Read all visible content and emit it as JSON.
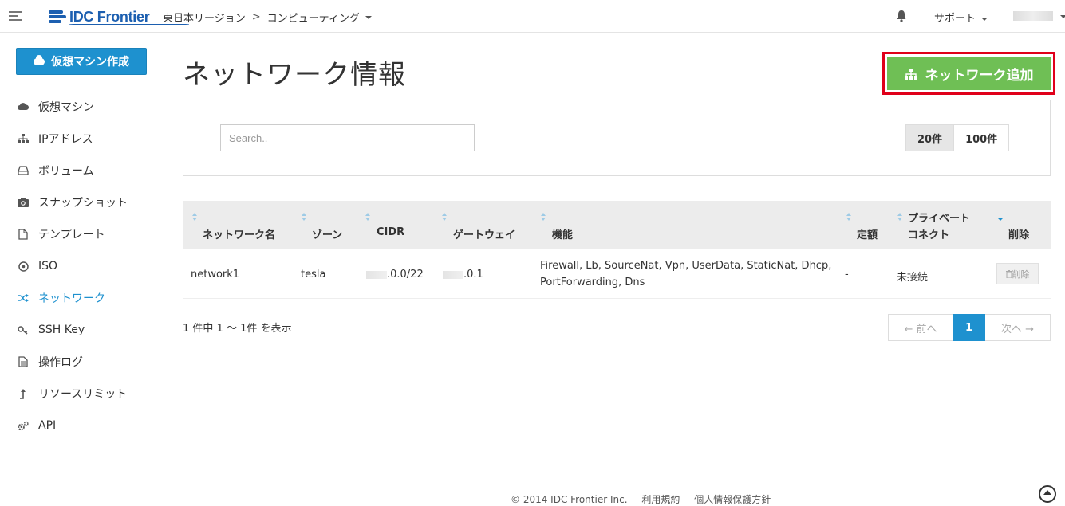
{
  "header": {
    "logo_text": "IDC Frontier",
    "region": "東日本リージョン",
    "breadcrumb_sep": ">",
    "section": "コンピューティング",
    "support": "サポート"
  },
  "sidebar": {
    "create_label": "仮想マシン作成",
    "items": [
      {
        "label": "仮想マシン",
        "icon": "cloud-icon"
      },
      {
        "label": "IPアドレス",
        "icon": "sitemap-icon"
      },
      {
        "label": "ボリューム",
        "icon": "hdd-icon"
      },
      {
        "label": "スナップショット",
        "icon": "camera-icon"
      },
      {
        "label": "テンプレート",
        "icon": "file-icon"
      },
      {
        "label": "ISO",
        "icon": "disc-icon"
      },
      {
        "label": "ネットワーク",
        "icon": "shuffle-icon",
        "active": true
      },
      {
        "label": "SSH Key",
        "icon": "key-icon"
      },
      {
        "label": "操作ログ",
        "icon": "document-icon"
      },
      {
        "label": "リソースリミット",
        "icon": "level-up-icon"
      },
      {
        "label": "API",
        "icon": "cogs-icon"
      }
    ]
  },
  "main": {
    "title": "ネットワーク情報",
    "add_label": "ネットワーク追加",
    "search_placeholder": "Search..",
    "page_sizes": [
      "20件",
      "100件"
    ],
    "columns": {
      "name": "ネットワーク名",
      "zone": "ゾーン",
      "cidr": "CIDR",
      "gateway": "ゲートウェイ",
      "features": "機能",
      "quota": "定額",
      "private_line": "プライベート",
      "private_line2": "コネクト",
      "delete": "削除"
    },
    "rows": [
      {
        "name": "network1",
        "zone": "tesla",
        "cidr_suffix": ".0.0/22",
        "gateway_suffix": ".0.1",
        "features_line1": "Firewall, Lb, SourceNat, Vpn, UserData, StaticNat, Dhcp,",
        "features_line2": "PortForwarding, Dns",
        "quota": "-",
        "private_connect": "未接続",
        "delete_label": "削除"
      }
    ],
    "summary": "1 件中 1 ～ 1件 を表示",
    "pager": {
      "prev": "← 前へ",
      "current": "1",
      "next": "次へ →"
    }
  },
  "footer": {
    "copyright": "© 2014 IDC Frontier Inc.",
    "terms": "利用規約",
    "privacy": "個人情報保護方針"
  },
  "colors": {
    "accent": "#1e91cf",
    "add_button": "#6fbf55",
    "highlight_border": "#e0001a"
  }
}
